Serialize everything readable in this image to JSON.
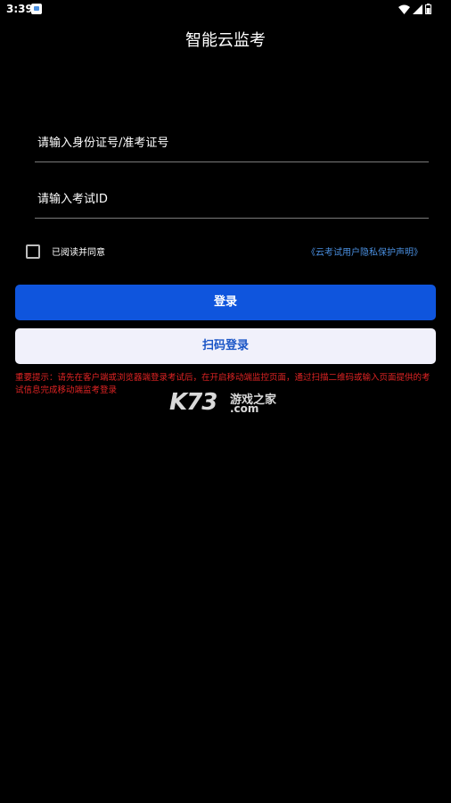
{
  "status_bar": {
    "time": "3:39",
    "icons": [
      "app-notification-icon",
      "wifi-icon",
      "signal-icon",
      "battery-icon"
    ]
  },
  "header": {
    "title": "智能云监考"
  },
  "form": {
    "id_input": {
      "placeholder": "请输入身份证号/准考证号",
      "value": ""
    },
    "exam_input": {
      "placeholder": "请输入考试ID",
      "value": ""
    },
    "agree_checked": false,
    "agree_label": "已阅读并同意",
    "privacy_link": "《云考试用户隐私保护声明》"
  },
  "buttons": {
    "login_label": "登录",
    "scan_label": "扫码登录"
  },
  "notice": {
    "text": "重要提示：请先在客户端或浏览器端登录考试后，在开启移动端监控页面，通过扫描二维码或输入页面提供的考试信息完成移动端监考登录"
  },
  "watermark": {
    "brand": "K73",
    "cn": "游戏之家",
    "domain": ".com"
  },
  "colors": {
    "background": "#000000",
    "primary": "#0f55dd",
    "secondary_bg": "#f1f1fb",
    "secondary_text": "#1a55c6",
    "link": "#4a8fe0",
    "warning": "#e02424"
  }
}
